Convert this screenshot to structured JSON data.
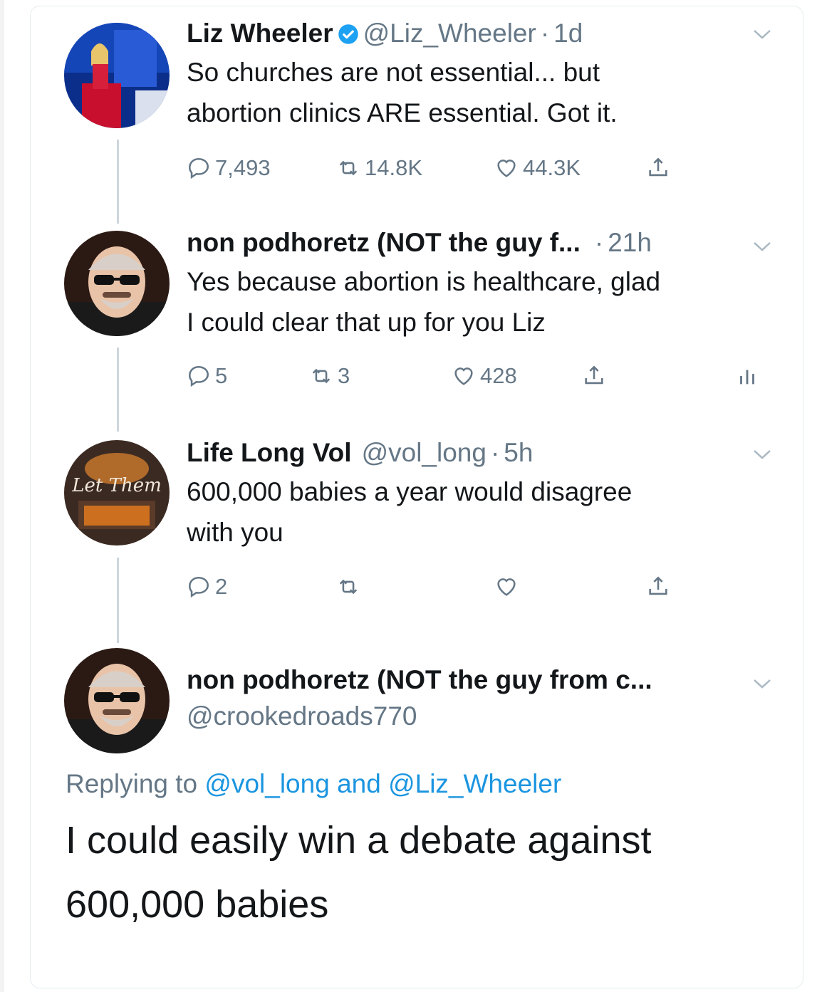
{
  "tweets": [
    {
      "name": "Liz Wheeler",
      "handle": "@Liz_Wheeler",
      "time": "1d",
      "verified": true,
      "text_line1": "So churches are not essential... but",
      "text_line2": "abortion clinics ARE essential. Got it.",
      "replies": "7,493",
      "retweets": "14.8K",
      "likes": "44.3K",
      "avatar": "woman-at-podium-avatar"
    },
    {
      "name": "non podhoretz (NOT the guy f...",
      "time": "21h",
      "text_line1": "Yes because abortion is healthcare, glad",
      "text_line2": "I could clear that up for you Liz",
      "replies": "5",
      "retweets": "3",
      "likes": "428",
      "avatar": "man-sunglasses-avatar"
    },
    {
      "name": "Life Long Vol",
      "handle": "@vol_long",
      "time": "5h",
      "text_line1": "600,000 babies a year would disagree",
      "text_line2": "with you",
      "replies": "2",
      "avatar": "let-them-logo-avatar",
      "avatar_text": "Let Them"
    }
  ],
  "focused": {
    "name": "non podhoretz (NOT the guy from c...",
    "handle": "@crookedroads770",
    "replying_prefix": "Replying to",
    "mention1": "@vol_long",
    "and": "and",
    "mention2": "@Liz_Wheeler",
    "text_line1": "I could easily win a debate against",
    "text_line2": "600,000 babies",
    "avatar": "man-sunglasses-avatar"
  },
  "separator": "·",
  "colors": {
    "text": "#14171a",
    "muted": "#657786",
    "link": "#1b95e0",
    "line": "#ccd6dd",
    "verified": "#1da1f2"
  }
}
